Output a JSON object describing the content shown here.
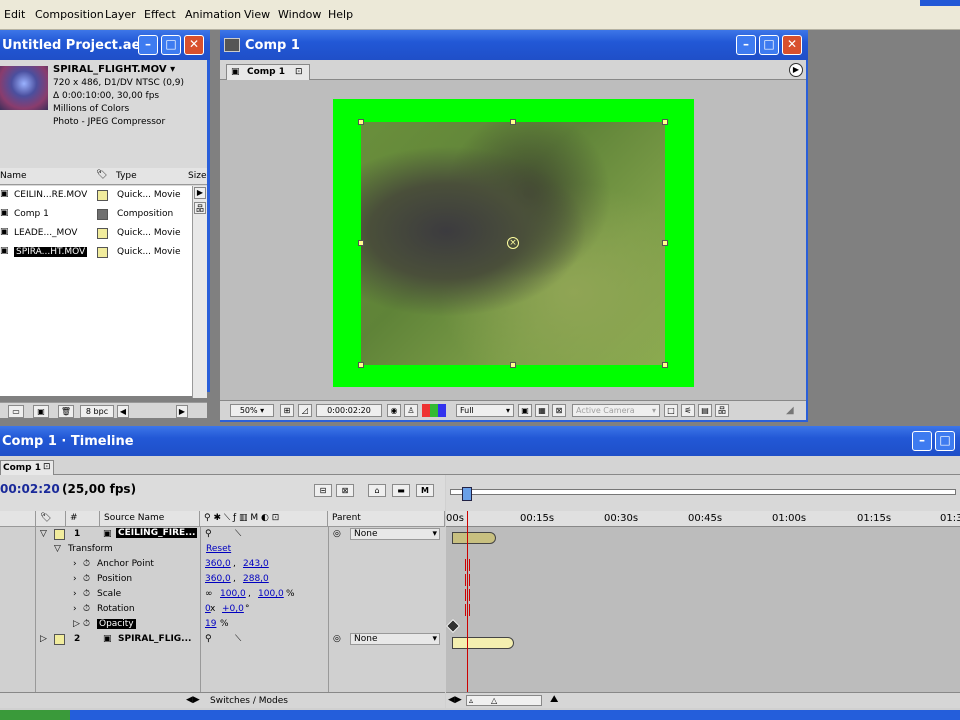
{
  "menu": [
    "Edit",
    "Composition",
    "Layer",
    "Effect",
    "Animation",
    "View",
    "Window",
    "Help"
  ],
  "project": {
    "title": "Untitled Project.ae...",
    "file_name": "SPIRAL_FLIGHT.MOV ▾",
    "info": [
      "720 x 486, D1/DV NTSC (0,9)",
      "Δ 0:00:10:00, 30,00 fps",
      "Millions of Colors",
      "Photo - JPEG Compressor"
    ],
    "columns": {
      "name": "Name",
      "type": "Type",
      "size": "Size"
    },
    "items": [
      {
        "name": "CEILIN...RE.MOV",
        "type": "Quick... Movie",
        "color": "#f1ec9d"
      },
      {
        "name": "Comp 1",
        "type": "Composition",
        "color": "#707070"
      },
      {
        "name": "LEADE..._MOV",
        "type": "Quick... Movie",
        "color": "#f1ec9d"
      },
      {
        "name": "SPIRA...HT.MOV",
        "type": "Quick... Movie",
        "color": "#f1ec9d"
      }
    ],
    "bpc": "8 bpc"
  },
  "comp": {
    "title": "Comp 1",
    "tab": "Comp 1",
    "zoom": "50%",
    "timecode": "0:00:02:20",
    "resolution": "Full",
    "camera": "Active Camera"
  },
  "timeline": {
    "title": "Comp 1 · Timeline",
    "tab": "Comp 1",
    "timecode": "00:02:20",
    "fps": "(25,00 fps)",
    "columns": {
      "num": "#",
      "source": "Source Name",
      "parent": "Parent"
    },
    "ruler": [
      "00s",
      "00:15s",
      "00:30s",
      "00:45s",
      "01:00s",
      "01:15s",
      "01:3"
    ],
    "layer1": {
      "num": "1",
      "name": "CEILING_FIRE...",
      "parent": "None"
    },
    "transform": {
      "label": "Transform",
      "reset": "Reset"
    },
    "props": [
      {
        "name": "Anchor Point",
        "v1": "360,0",
        "sep": " , ",
        "v2": "243,0",
        "unit": ""
      },
      {
        "name": "Position",
        "v1": "360,0",
        "sep": " , ",
        "v2": "288,0",
        "unit": ""
      },
      {
        "name": "Scale",
        "v1": "100,0",
        "sep": " , ",
        "v2": "100,0",
        "unit": "%"
      },
      {
        "name": "Rotation",
        "v1": "0",
        "sep": " x ",
        "v2": "+0,0",
        "unit": "°"
      },
      {
        "name": "Opacity",
        "v1": "19",
        "sep": "",
        "v2": "",
        "unit": "%"
      }
    ],
    "layer2": {
      "num": "2",
      "name": "SPIRAL_FLIG...",
      "parent": "None"
    },
    "switches_modes": "Switches / Modes"
  },
  "colors": {
    "title_blue": "#245edb",
    "comp_green": "#00ff00",
    "playhead": "#cc0000",
    "selected_layer": "#000000"
  }
}
